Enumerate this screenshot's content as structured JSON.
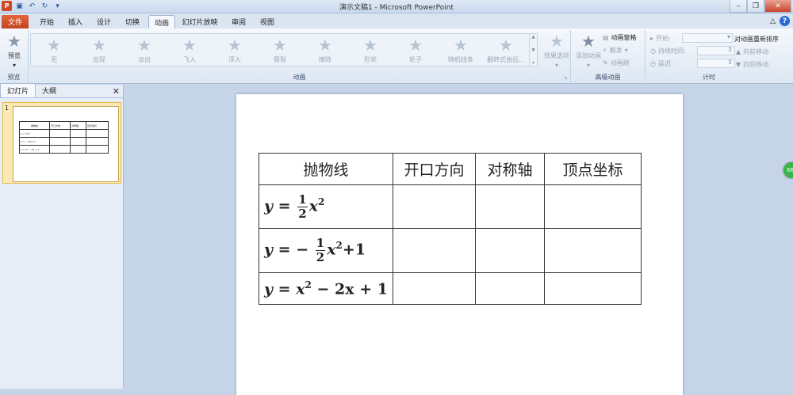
{
  "window": {
    "title": "演示文稿1 - Microsoft PowerPoint",
    "app_icon": "P",
    "qat": [
      "save-icon",
      "undo-icon",
      "redo-icon",
      "customize-icon"
    ]
  },
  "tabs": [
    "文件",
    "开始",
    "插入",
    "设计",
    "切换",
    "动画",
    "幻灯片放映",
    "审阅",
    "视图"
  ],
  "active_tab": "动画",
  "ribbon": {
    "preview": {
      "label": "预览",
      "group": "预览"
    },
    "animations": [
      "无",
      "出现",
      "淡出",
      "飞入",
      "浮入",
      "劈裂",
      "擦除",
      "形状",
      "轮子",
      "随机线条",
      "翻转式由远..."
    ],
    "effect_options": "效果选项",
    "animation_group_label": "动画",
    "advanced": {
      "add_animation": "添加动画",
      "animation_pane": "动画窗格",
      "trigger": "触发",
      "animation_painter": "动画刷",
      "group": "高级动画"
    },
    "timing": {
      "start": "开始:",
      "duration": "持续时间:",
      "delay": "延迟:",
      "reorder_title": "对动画重新排序",
      "move_earlier": "向前移动",
      "move_later": "向后移动",
      "group": "计时"
    }
  },
  "panel": {
    "tabs": [
      "幻灯片",
      "大纲"
    ],
    "active": "幻灯片",
    "slide_number": "1"
  },
  "slide": {
    "headers": [
      "抛物线",
      "开口方向",
      "对称轴",
      "顶点坐标"
    ],
    "rows": [
      {
        "lhs": "y",
        "eq": "=",
        "frac_num": "1",
        "frac_den": "2",
        "var": "x",
        "exp": "2",
        "tail": ""
      },
      {
        "lhs": "y",
        "eq": "= −",
        "frac_num": "1",
        "frac_den": "2",
        "var": "x",
        "exp": "2",
        "tail": "+1"
      },
      {
        "lhs": "y",
        "eq": "=",
        "var": "x",
        "exp": "2",
        "tail": " − 2x + 1"
      }
    ]
  },
  "thumb": {
    "headers": [
      "抛物线",
      "开口方向",
      "对称轴",
      "顶点坐标"
    ],
    "rows": [
      "y = ½x²",
      "y = −½x²+1",
      "y = x² − 2x + 1"
    ]
  },
  "addin_badge": "66"
}
